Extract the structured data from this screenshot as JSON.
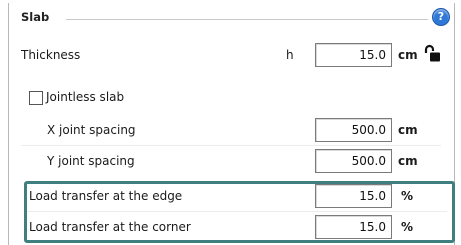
{
  "section": {
    "title": "Slab"
  },
  "thickness": {
    "label": "Thickness",
    "symbol": "h",
    "value": "15.0",
    "unit": "cm"
  },
  "jointless": {
    "label": "Jointless slab",
    "checked": false
  },
  "x_joint": {
    "label": "X joint spacing",
    "value": "500.0",
    "unit": "cm"
  },
  "y_joint": {
    "label": "Y joint spacing",
    "value": "500.0",
    "unit": "cm"
  },
  "edge_transfer": {
    "label": "Load transfer at the edge",
    "value": "15.0",
    "unit": "%"
  },
  "corner_transfer": {
    "label": "Load transfer at the corner",
    "value": "15.0",
    "unit": "%"
  },
  "icons": {
    "help": "help-icon",
    "lock": "unlock-icon"
  },
  "colors": {
    "highlight": "#3f7f7f",
    "help": "#2e78d6"
  }
}
